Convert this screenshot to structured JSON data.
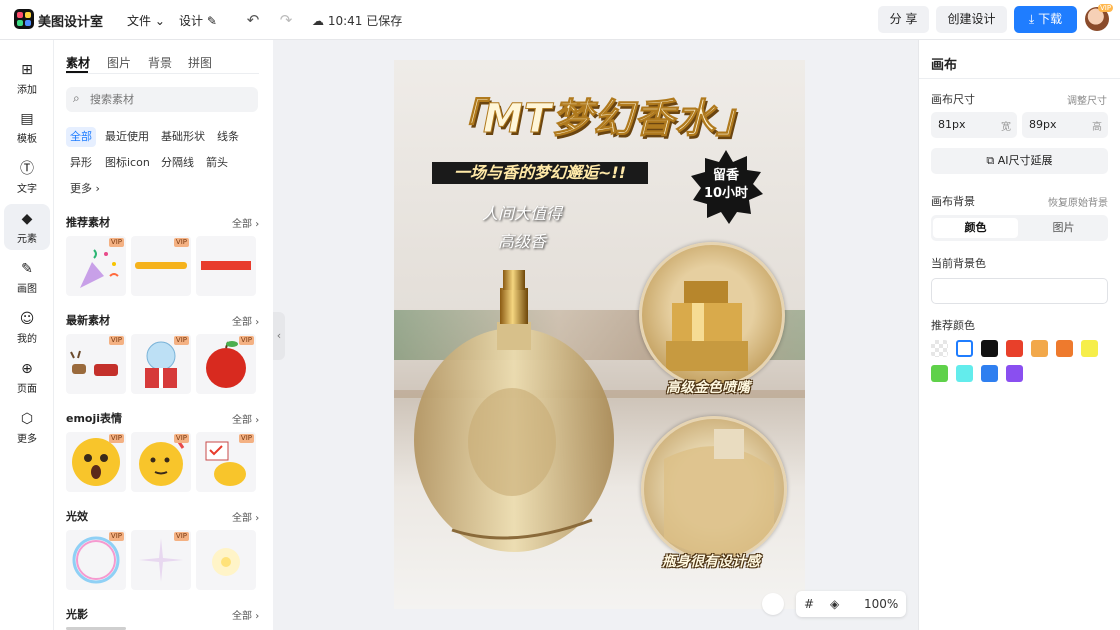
{
  "topbar": {
    "brand": "美图设计室",
    "menu_file": "文件",
    "menu_design": "设计",
    "save_status": "10:41 已保存",
    "share": "分 享",
    "create": "创建设计",
    "download": "下载",
    "avatar_badge": "VIP"
  },
  "rail": {
    "items": [
      {
        "label": "添加",
        "icon": "plus-square-icon"
      },
      {
        "label": "模板",
        "icon": "template-icon"
      },
      {
        "label": "文字",
        "icon": "text-icon"
      },
      {
        "label": "元素",
        "icon": "shapes-icon"
      },
      {
        "label": "画图",
        "icon": "draw-icon"
      },
      {
        "label": "我的",
        "icon": "user-icon"
      },
      {
        "label": "页面",
        "icon": "page-add-icon"
      },
      {
        "label": "更多",
        "icon": "cube-icon"
      }
    ]
  },
  "panel": {
    "tabs": [
      "素材",
      "图片",
      "背景",
      "拼图"
    ],
    "search_placeholder": "搜索素材",
    "chips": [
      "全部",
      "最近使用",
      "基础形状",
      "线条",
      "异形",
      "图标icon",
      "分隔线",
      "箭头",
      "更多"
    ],
    "all_label": "全部",
    "vip": "VIP",
    "sections": [
      {
        "title": "推荐素材"
      },
      {
        "title": "最新素材"
      },
      {
        "title": "emoji表情"
      },
      {
        "title": "光效"
      },
      {
        "title": "光影"
      }
    ]
  },
  "poster": {
    "title": "「MT梦幻香水」",
    "subtitle": "一场与香的梦幻邂逅~!!",
    "badge_line1": "留香",
    "badge_line2": "10小时",
    "line1": "人间大值得",
    "line2": "高级香",
    "caption_top": "高级金色喷嘴",
    "caption_bottom": "瓶身很有设计感"
  },
  "zoom": {
    "value": "100%"
  },
  "right": {
    "title": "画布",
    "size_label": "画布尺寸",
    "adjust": "调整尺寸",
    "width_value": "81px",
    "width_unit": "宽",
    "height_value": "89px",
    "height_unit": "高",
    "ai_extend": "AI尺寸延展",
    "bg_label": "画布背景",
    "bg_reset": "恢复原始背景",
    "seg_color": "颜色",
    "seg_image": "图片",
    "current_bg": "当前背景色",
    "recommended": "推荐颜色",
    "swatches": [
      "transparent",
      "#ffffff",
      "#111111",
      "#e8402a",
      "#f2a84a",
      "#ee7a2d",
      "#f6ee4a",
      "#5fd14a",
      "#63ecec",
      "#2f7ff0",
      "#8a4ff0"
    ]
  }
}
